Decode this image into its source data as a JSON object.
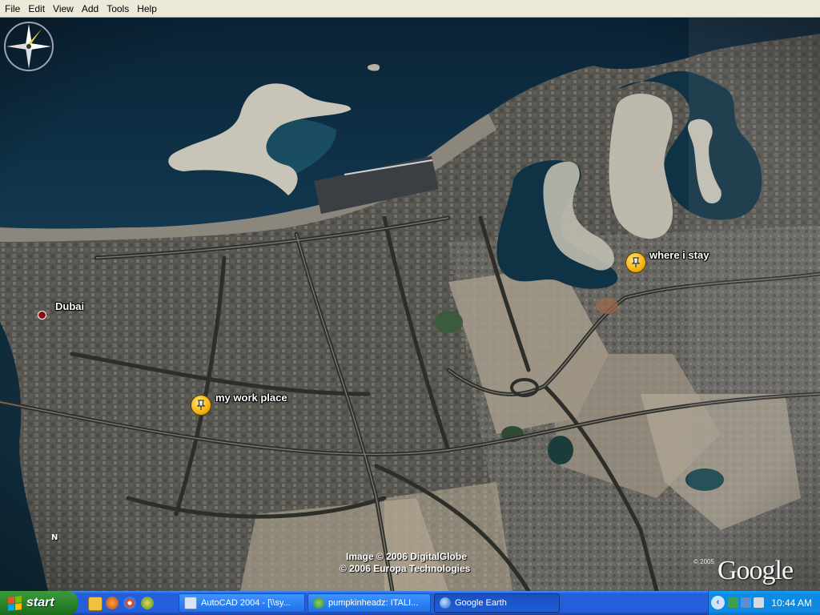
{
  "menu": {
    "items": [
      "File",
      "Edit",
      "View",
      "Add",
      "Tools",
      "Help"
    ]
  },
  "map": {
    "placemarks": {
      "dubai": "Dubai",
      "work": "my work place",
      "stay": "where i stay"
    },
    "copyright_line1": "Image © 2006 DigitalGlobe",
    "copyright_line2": "© 2006 Europa Technologies",
    "copyright_year": "© 2005",
    "logo": "Google",
    "compass_n": "N"
  },
  "taskbar": {
    "start_label": "start",
    "tasks": [
      {
        "label": "AutoCAD 2004 - [\\\\sy...",
        "icon": "autocad-icon"
      },
      {
        "label": "pumpkinheadz: ITALI...",
        "icon": "messenger-icon"
      },
      {
        "label": "Google Earth",
        "icon": "google-earth-icon"
      }
    ],
    "clock": "10:44 AM"
  },
  "colors": {
    "taskbar_blue": "#245edb",
    "start_green": "#2f8a2f",
    "tray_blue": "#0c8ae4",
    "sea": "#0d2b43",
    "placemark_gold": "#f2b30f"
  }
}
